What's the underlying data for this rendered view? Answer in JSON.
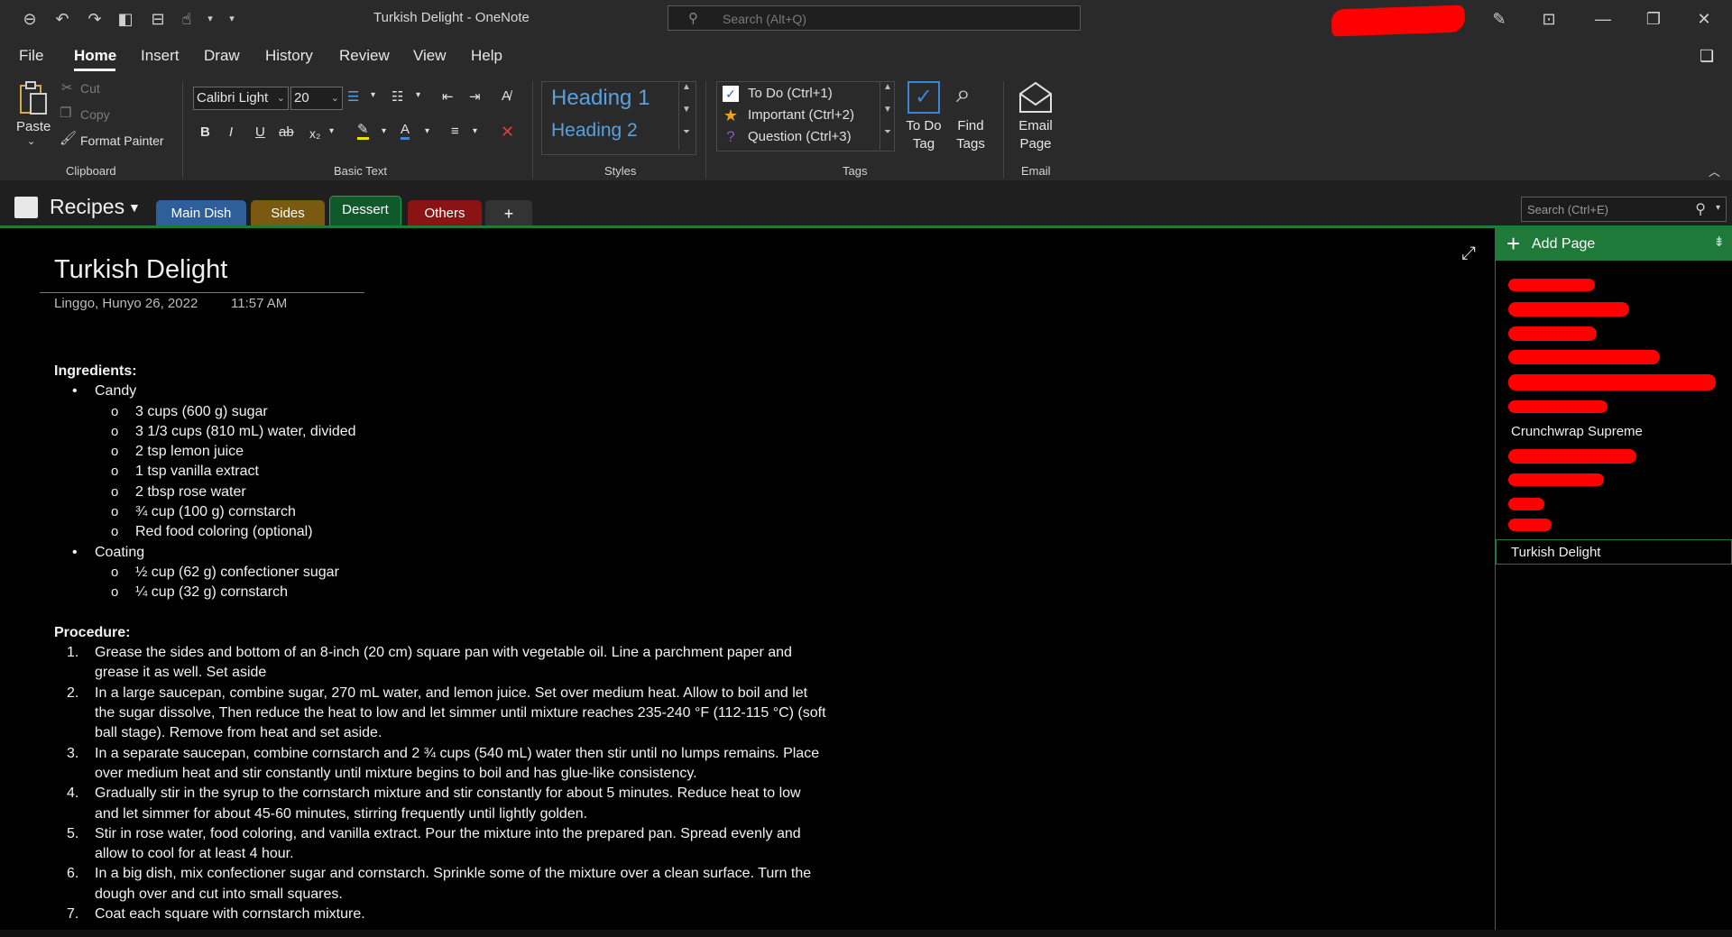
{
  "window": {
    "title": "Turkish Delight  -  OneNote",
    "search_placeholder": "Search (Alt+Q)"
  },
  "menu": [
    "File",
    "Home",
    "Insert",
    "Draw",
    "History",
    "Review",
    "View",
    "Help"
  ],
  "ribbon": {
    "clipboard": {
      "paste": "Paste",
      "cut": "Cut",
      "copy": "Copy",
      "format_painter": "Format Painter",
      "label": "Clipboard"
    },
    "basic_text": {
      "font_name": "Calibri Light",
      "font_size": "20",
      "bold": "B",
      "italic": "I",
      "underline": "U",
      "strike": "ab",
      "subscript": "x₂",
      "label": "Basic Text"
    },
    "styles": {
      "heading1": "Heading 1",
      "heading2": "Heading 2",
      "label": "Styles"
    },
    "tags": {
      "todo": "To Do (Ctrl+1)",
      "important": "Important (Ctrl+2)",
      "question": "Question (Ctrl+3)",
      "todo_tag_line1": "To Do",
      "todo_tag_line2": "Tag",
      "find_tags_line1": "Find",
      "find_tags_line2": "Tags",
      "label": "Tags"
    },
    "email": {
      "line1": "Email",
      "line2": "Page",
      "label": "Email"
    }
  },
  "notebook": {
    "name": "Recipes",
    "sections": [
      {
        "label": "Main Dish",
        "color": "#2f5f9a"
      },
      {
        "label": "Sides",
        "color": "#7a5a10"
      },
      {
        "label": "Dessert",
        "color": "#0f5a2a"
      },
      {
        "label": "Others",
        "color": "#8a1414"
      }
    ],
    "add_section": "+",
    "search_placeholder": "Search (Ctrl+E)"
  },
  "page": {
    "title": "Turkish Delight",
    "date": "Linggo, Hunyo 26, 2022",
    "time": "11:57 AM",
    "ingredients_heading": "Ingredients:",
    "groups": [
      {
        "name": "Candy",
        "items": [
          "3 cups (600 g) sugar",
          "3 1/3 cups (810 mL) water, divided",
          "2 tsp lemon juice",
          "1 tsp vanilla extract",
          "2 tbsp rose water",
          "¾ cup (100 g) cornstarch",
          "Red food coloring (optional)"
        ]
      },
      {
        "name": "Coating",
        "items": [
          "½ cup (62 g) confectioner sugar",
          "¼ cup (32 g) cornstarch"
        ]
      }
    ],
    "procedure_heading": "Procedure:",
    "steps": [
      {
        "num": "1.",
        "lines": [
          "Grease the sides and bottom of an 8-inch (20 cm) square pan with vegetable oil. Line a parchment paper and",
          "grease it as well. Set aside"
        ]
      },
      {
        "num": "2.",
        "lines": [
          "In a large saucepan, combine sugar, 270 mL water, and lemon juice. Set over medium heat. Allow to boil and let",
          "the sugar dissolve, Then reduce the heat to low and let simmer until mixture reaches 235-240 °F (112-115 °C) (soft",
          "ball stage). Remove from heat and set aside."
        ]
      },
      {
        "num": "3.",
        "lines": [
          "In a separate saucepan, combine cornstarch and 2 ¾ cups (540 mL) water then stir until no lumps remains. Place",
          "over medium heat and stir constantly until mixture begins to boil and has glue-like consistency."
        ]
      },
      {
        "num": "4.",
        "lines": [
          "Gradually stir in the syrup to the cornstarch mixture and stir constantly for about 5 minutes. Reduce heat to low",
          "and let simmer for about 45-60 minutes, stirring frequently until lightly golden."
        ]
      },
      {
        "num": "5.",
        "lines": [
          "Stir in rose water, food coloring, and vanilla extract. Pour the mixture into the prepared pan. Spread evenly and",
          "allow to cool for at least 4 hour."
        ]
      },
      {
        "num": "6.",
        "lines": [
          "In a big dish, mix confectioner sugar and cornstarch. Sprinkle some of the mixture over a clean surface. Turn the",
          "dough over and cut into small squares."
        ]
      },
      {
        "num": "7.",
        "lines": [
          "Coat each square with cornstarch mixture."
        ]
      }
    ]
  },
  "pagelist": {
    "add_page": "Add Page",
    "visible_pages": [
      "Crunchwrap Supreme",
      "Turkish Delight"
    ],
    "selected": "Turkish Delight"
  }
}
